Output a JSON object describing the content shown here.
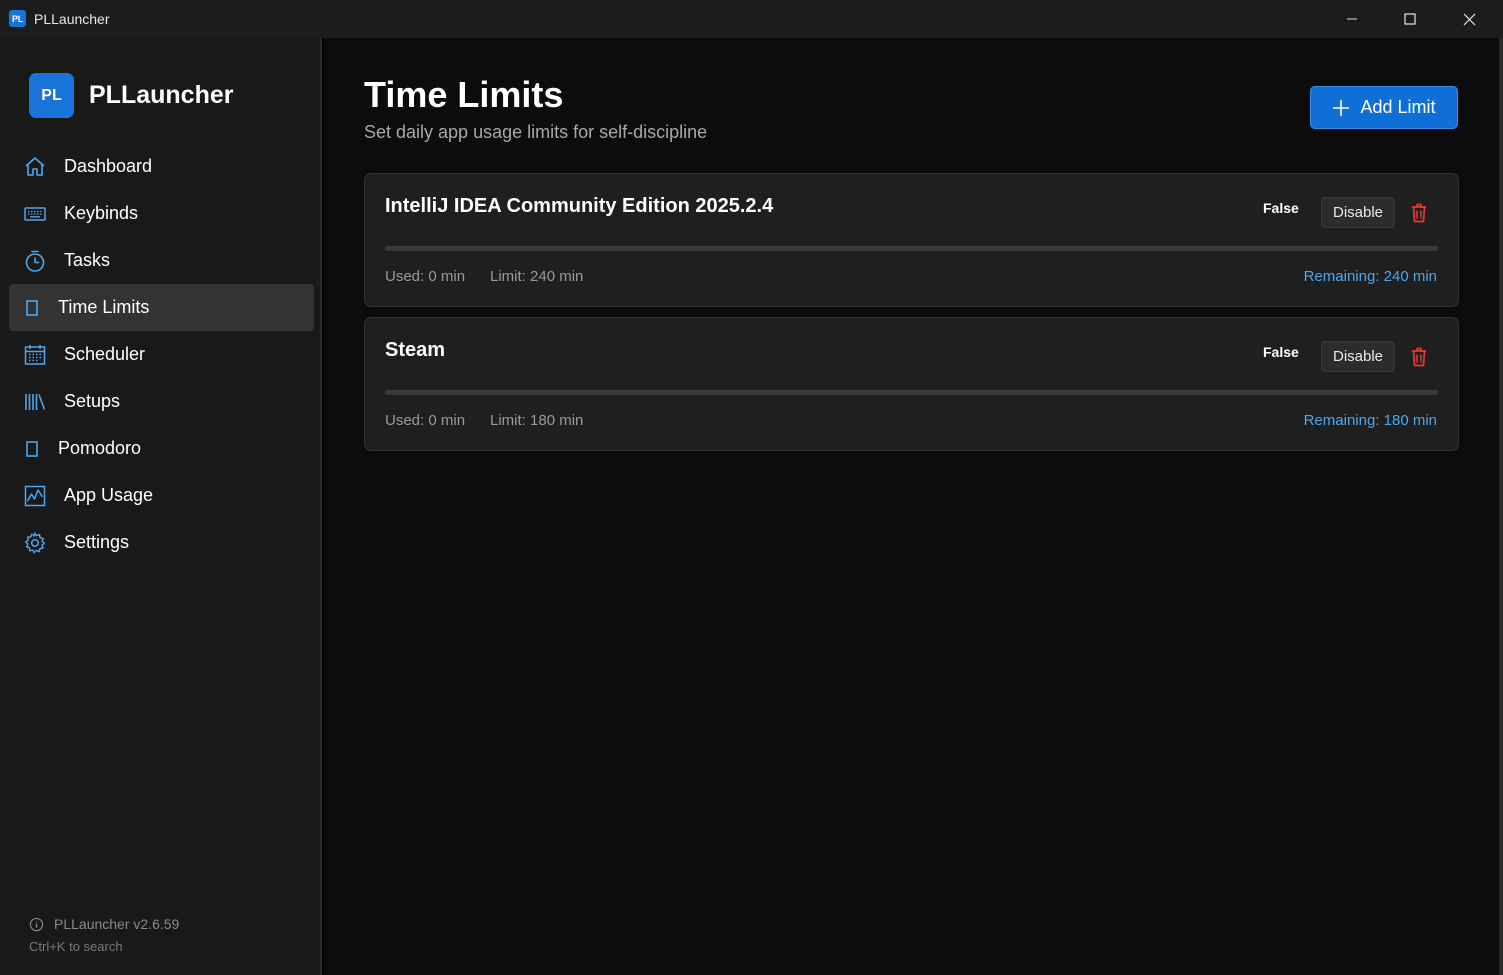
{
  "window": {
    "app_icon_text": "PL",
    "title": "PLLauncher"
  },
  "sidebar": {
    "brand_logo_text": "PL",
    "brand_name": "PLLauncher",
    "items": [
      {
        "label": "Dashboard",
        "icon": "home-icon"
      },
      {
        "label": "Keybinds",
        "icon": "keyboard-icon"
      },
      {
        "label": "Tasks",
        "icon": "timer-icon"
      },
      {
        "label": "Time Limits",
        "icon": "rectangle-icon",
        "active": true
      },
      {
        "label": "Scheduler",
        "icon": "calendar-icon"
      },
      {
        "label": "Setups",
        "icon": "library-icon"
      },
      {
        "label": "Pomodoro",
        "icon": "rectangle-icon"
      },
      {
        "label": "App Usage",
        "icon": "chart-icon"
      },
      {
        "label": "Settings",
        "icon": "gear-icon"
      }
    ],
    "footer": {
      "version": "PLLauncher v2.6.59",
      "hint": "Ctrl+K to search"
    }
  },
  "main": {
    "title": "Time Limits",
    "subtitle": "Set daily app usage limits for self-discipline",
    "add_button_label": "Add Limit",
    "limits": [
      {
        "name": "IntelliJ IDEA Community Edition 2025.2.4",
        "state": "False",
        "disable_label": "Disable",
        "used": "Used: 0 min",
        "limit": "Limit: 240 min",
        "remaining": "Remaining: 240 min",
        "progress": 0
      },
      {
        "name": "Steam",
        "state": "False",
        "disable_label": "Disable",
        "used": "Used: 0 min",
        "limit": "Limit: 180 min",
        "remaining": "Remaining: 180 min",
        "progress": 0
      }
    ]
  },
  "colors": {
    "accent": "#1a73d9",
    "remaining_text": "#4aa8f0",
    "danger": "#e53935",
    "active_nav": "#333333"
  }
}
